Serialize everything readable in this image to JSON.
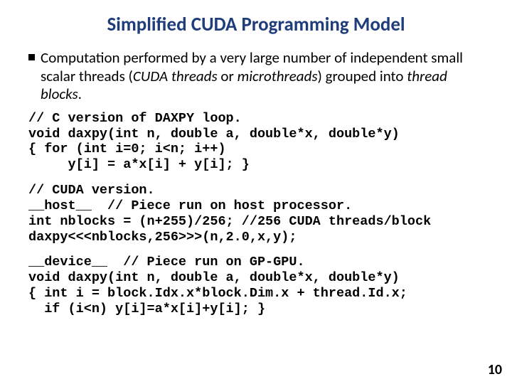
{
  "title": "Simplified CUDA Programming Model",
  "bullet": {
    "pre": "Computation performed by a very large number of independent small scalar threads (",
    "i1": "CUDA threads",
    "mid1": " or ",
    "i2": "microthreads",
    "mid2": ") grouped into ",
    "i3": "thread blocks",
    "post": "."
  },
  "code1": "// C version of DAXPY loop.\nvoid daxpy(int n, double a, double*x, double*y)\n{ for (int i=0; i<n; i++)\n     y[i] = a*x[i] + y[i]; }",
  "code2": "// CUDA version.\n__host__  // Piece run on host processor.\nint nblocks = (n+255)/256; //256 CUDA threads/block\ndaxpy<<<nblocks,256>>>(n,2.0,x,y);",
  "code3": "__device__  // Piece run on GP-GPU.\nvoid daxpy(int n, double a, double*x, double*y)\n{ int i = block.Idx.x*block.Dim.x + thread.Id.x;\n  if (i<n) y[i]=a*x[i]+y[i]; }",
  "pagenum": "10"
}
